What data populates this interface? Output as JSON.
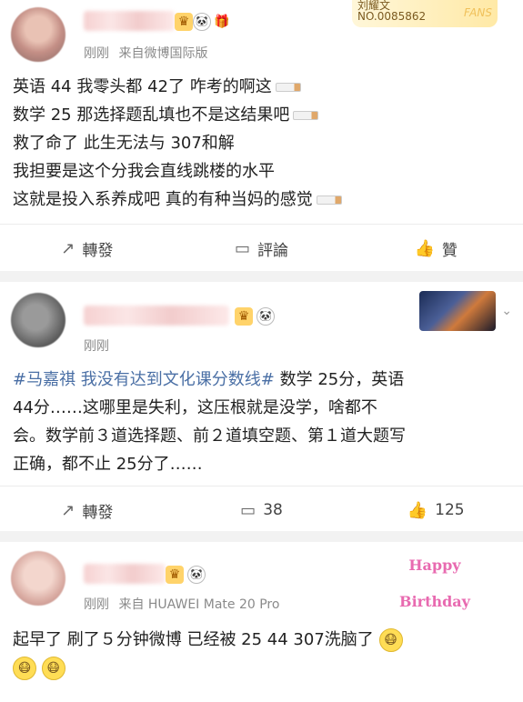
{
  "post1": {
    "meta_time": "刚刚",
    "meta_source": "来自微博国际版",
    "fans_badge": {
      "name": "刘耀文",
      "number": "NO.0085862",
      "tag": "FANS"
    },
    "lines": [
      "英语 44 我零头都 42了 咋考的啊这",
      "数学 25 那选择题乱填也不是这结果吧",
      "救了命了 此生无法与 307和解",
      "我担要是这个分我会直线跳楼的水平",
      "这就是投入系养成吧 真的有种当妈的感觉"
    ],
    "actions": {
      "repost": "轉發",
      "comment": "評論",
      "like": "贊"
    }
  },
  "post2": {
    "meta_time": "刚刚",
    "hashtag": "#马嘉祺 我没有达到文化课分数线#",
    "lines": [
      "数学 25分，英语",
      "44分……这哪里是失利，这压根就是没学，啥都不",
      "会。数学前３道选择题、前２道填空题、第１道大题写",
      "正确，都不止 25分了……"
    ],
    "actions": {
      "repost": "轉發",
      "comment": "38",
      "like": "125"
    }
  },
  "post3": {
    "meta_time": "刚刚",
    "meta_source": "来自 HUAWEI Mate 20 Pro",
    "birthday": "Happy Birthday",
    "lines": [
      "起早了 刷了５分钟微博 已经被 25 44 307洗脑了"
    ]
  },
  "icons": {
    "repost": "share-icon",
    "comment": "comment-icon",
    "like": "thumbs-up-icon"
  }
}
